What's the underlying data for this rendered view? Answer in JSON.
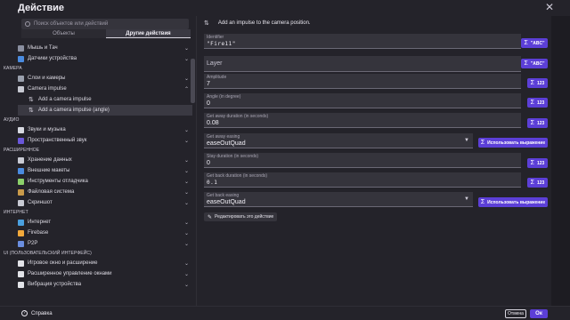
{
  "dialog": {
    "title": "Действие",
    "close": "✕"
  },
  "search": {
    "placeholder": "Поиск объектов или действий"
  },
  "tabs": {
    "objects": "Объекты",
    "other_actions": "Другие действия"
  },
  "tree": [
    {
      "kind": "row",
      "label": "Мышь и Тач",
      "icon": "mouse-icon",
      "color": "#8a8fa0",
      "chev": "⌄"
    },
    {
      "kind": "row",
      "label": "Датчики устройства",
      "icon": "phone-icon",
      "color": "#4a8be0",
      "chev": "⌄"
    },
    {
      "kind": "cat",
      "label": "КАМЕРА"
    },
    {
      "kind": "row",
      "label": "Слои и камеры",
      "icon": "camera-icon",
      "color": "#9aa0ad",
      "chev": "⌄"
    },
    {
      "kind": "row",
      "label": "Camera impulse",
      "icon": "impulse-icon",
      "color": "#c7c9d2",
      "chev": "⌃"
    },
    {
      "kind": "sub",
      "label": "Add a camera impulse",
      "icon": "arrows-icon"
    },
    {
      "kind": "sub-sel",
      "label": "Add a camera impulse (angle)",
      "icon": "arrows-icon"
    },
    {
      "kind": "cat",
      "label": "АУДИО"
    },
    {
      "kind": "row",
      "label": "Звуки и музыка",
      "icon": "music-icon",
      "color": "#d7d9e0",
      "chev": "⌄"
    },
    {
      "kind": "row",
      "label": "Пространственный звук",
      "icon": "spatial-sound-icon",
      "color": "#6a57d9",
      "chev": "⌄"
    },
    {
      "kind": "cat",
      "label": "РАСШИРЕННОЕ"
    },
    {
      "kind": "row",
      "label": "Хранение данных",
      "icon": "storage-icon",
      "color": "#c9cbd4",
      "chev": "⌄"
    },
    {
      "kind": "row",
      "label": "Внешние макеты",
      "icon": "layout-icon",
      "color": "#4a8be0",
      "chev": "⌄"
    },
    {
      "kind": "row",
      "label": "Инструменты отладчика",
      "icon": "debug-icon",
      "color": "#8bd06a",
      "chev": "⌄"
    },
    {
      "kind": "row",
      "label": "Файловая система",
      "icon": "folder-icon",
      "color": "#c99a4a",
      "chev": "⌄"
    },
    {
      "kind": "row",
      "label": "Скриншот",
      "icon": "screenshot-icon",
      "color": "#c8cad3",
      "chev": "⌄"
    },
    {
      "kind": "cat",
      "label": "ИНТЕРНЕТ"
    },
    {
      "kind": "row",
      "label": "Интернет",
      "icon": "globe-icon",
      "color": "#4aa0e0",
      "chev": "⌄"
    },
    {
      "kind": "row",
      "label": "Firebase",
      "icon": "firebase-icon",
      "color": "#f2a93b",
      "chev": "⌄"
    },
    {
      "kind": "row",
      "label": "P2P",
      "icon": "p2p-icon",
      "color": "#6a8ee0",
      "chev": "⌄"
    },
    {
      "kind": "cat",
      "label": "UI (ПОЛЬЗОВАТЕЛЬСКИЙ ИНТЕРФЕЙС)"
    },
    {
      "kind": "row",
      "label": "Игровое окно и расширение",
      "icon": "window-icon",
      "color": "#e2e3e8",
      "chev": "⌄"
    },
    {
      "kind": "row",
      "label": "Расширенное управление окнами",
      "icon": "window-manage-icon",
      "color": "#e2e3e8",
      "chev": "⌄"
    },
    {
      "kind": "row",
      "label": "Вибрация устройства",
      "icon": "vibration-icon",
      "color": "#e2e3e8",
      "chev": "⌄"
    }
  ],
  "action": {
    "symbol": "⇅",
    "title": "Add an impulse to the camera position."
  },
  "fields": {
    "identifier": {
      "label": "Identifier",
      "value": "\"Fire11\"",
      "button": "\"ABC\""
    },
    "layer": {
      "placeholder": "Layer",
      "button": "\"ABC\""
    },
    "amplitude": {
      "label": "Amplitude",
      "value": "7",
      "button": "123"
    },
    "angle": {
      "label": "Angle (in degree)",
      "value": "0",
      "button": "123"
    },
    "get_away": {
      "label": "Get away duration (in seconds)",
      "value": "0.08",
      "button": "123"
    },
    "get_away_easing": {
      "label": "Get away easing",
      "value": "easeOutQuad",
      "button": "Использовать выражение"
    },
    "stay": {
      "label": "Stay duration (in seconds)",
      "value": "0",
      "button": "123"
    },
    "get_back": {
      "label": "Get back duration (in seconds)",
      "value": "0.1",
      "button": "123"
    },
    "get_back_easing": {
      "label": "Get back easing",
      "value": "easeOutQuad",
      "button": "Использовать выражение"
    }
  },
  "edit_action": "Редактировать это действие",
  "footer": {
    "help": "Справка",
    "cancel": "Отмена",
    "ok": "Ок"
  },
  "colors": {
    "accent": "#5c3fd7",
    "background": "#24232a",
    "field": "#35343c"
  }
}
